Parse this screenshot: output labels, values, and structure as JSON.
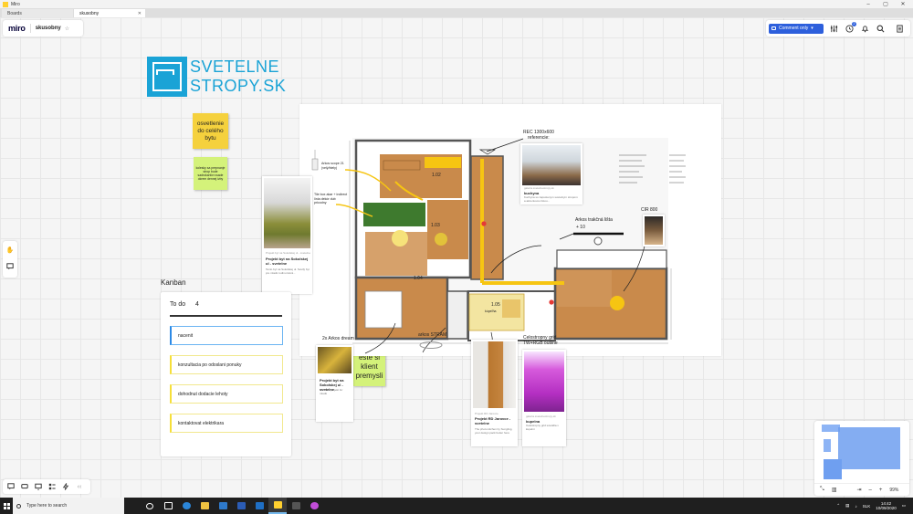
{
  "window": {
    "app_name": "Miro",
    "minimize": "–",
    "maximize": "▢",
    "close": "✕"
  },
  "tabs": [
    {
      "label": "Boards"
    },
    {
      "label": "skusobny",
      "close": "✕"
    }
  ],
  "header": {
    "logo": "miro",
    "board_name": "skusobny",
    "star": "☆"
  },
  "toolbar_right": {
    "comment_label": "Comment only",
    "comment_caret": "▾",
    "notification_count": "2"
  },
  "branding": {
    "line1": "SVETELNE",
    "line2": "STROPY.SK"
  },
  "stickies": {
    "orange": "osvetlenie do celého bytu",
    "green_small": "kolesky sa prepnanje strop bude sadrokartón vsade okrem dennej izby",
    "green_big": "este si klient premysli"
  },
  "annotations": {
    "rec": "REC 1300x600",
    "referencie": "referencie:",
    "arkos_scope": "Arkos scope 21 (velý/biely)",
    "tile_box": "Tile box akar + indirect línia dekór dub pricodny",
    "trakcna": "Arkos trakčná lišta",
    "trakcna_sub": "+ 10",
    "cir": "CIR 800",
    "dream": "2x Arkos dream",
    "stram": "arkos STRAM",
    "celostropny": "Celostropny grid TW+RGB outline",
    "room_102": "1.02",
    "room_103": "1.03",
    "room_104": "1.04",
    "room_105": "1.05",
    "room_105_sub": "kúpeľňa"
  },
  "cards": {
    "living": {
      "link": "Projekt byt na Sokolskej ul - svetelne",
      "title": "Projekt byt na Sokolskej ul - svetelne",
      "text": "Tento byt na Sokolskej ul. Svetlý byt pre mladú rodinu ktorá..."
    },
    "kitchen": {
      "link": "galeria.svetelnestropy.sk",
      "title": "kuchyna",
      "text": "Kuchyna so zapustenym svetelnym stropom a akcentovou listou..."
    },
    "bathroom": {
      "link": "Projekt RD Jarovce",
      "title": "Projekt RD Jarovce - svetelne",
      "text": "The photo kitchen by Sungling, your design pack better here"
    },
    "pink": {
      "link": "galeria.svetelnestropy.sk",
      "title": "kupelna",
      "text": "Celostropny grid svietidla v kupelni"
    },
    "dream": {
      "title": "Projekt byt na Sokolskej ul - svetelne",
      "text": "This is a projekt for mladú"
    }
  },
  "kanban": {
    "title": "Kanban",
    "column": "To do",
    "count": "4",
    "cards": [
      "nacenit",
      "konzultacia po odoslani ponuky",
      "dohodnut dodacie lehoty",
      "kontaktovat elektrikara"
    ]
  },
  "zoom": {
    "level": "99%",
    "minus": "–",
    "plus": "+"
  },
  "taskbar": {
    "search_placeholder": "Type here to search",
    "language": "SLK",
    "time": "14:42",
    "date": "10/09/2020"
  },
  "colors": {
    "accent": "#2d5fdc",
    "brand_blue": "#1aa3d6",
    "sticky_orange": "#f5d13d",
    "sticky_green": "#d4f27a",
    "floor_wood": "#c98a4b"
  }
}
